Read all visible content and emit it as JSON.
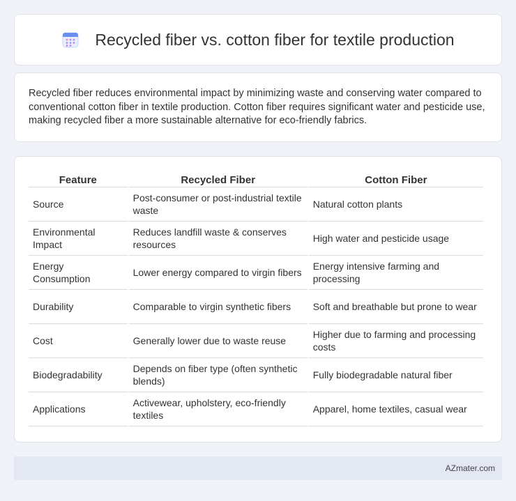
{
  "header": {
    "title": "Recycled fiber vs. cotton fiber for textile production",
    "icon": "calendar-icon"
  },
  "summary": {
    "text": "Recycled fiber reduces environmental impact by minimizing waste and conserving water compared to conventional cotton fiber in textile production. Cotton fiber requires significant water and pesticide use, making recycled fiber a more sustainable alternative for eco-friendly fabrics."
  },
  "table": {
    "headers": [
      "Feature",
      "Recycled Fiber",
      "Cotton Fiber"
    ],
    "rows": [
      [
        "Source",
        "Post-consumer or post-industrial textile waste",
        "Natural cotton plants"
      ],
      [
        "Environmental Impact",
        "Reduces landfill waste & conserves resources",
        "High water and pesticide usage"
      ],
      [
        "Energy Consumption",
        "Lower energy compared to virgin fibers",
        "Energy intensive farming and processing"
      ],
      [
        "Durability",
        "Comparable to virgin synthetic fibers",
        "Soft and breathable but prone to wear"
      ],
      [
        "Cost",
        "Generally lower due to waste reuse",
        "Higher due to farming and processing costs"
      ],
      [
        "Biodegradability",
        "Depends on fiber type (often synthetic blends)",
        "Fully biodegradable natural fiber"
      ],
      [
        "Applications",
        "Activewear, upholstery, eco-friendly textiles",
        "Apparel, home textiles, casual wear"
      ]
    ]
  },
  "footer": {
    "brand": "AZmater.com"
  },
  "colors": {
    "background": "#f0f2f7",
    "card": "#ffffff",
    "footer": "#e4e8f3",
    "icon_accent": "#6b8ff0"
  }
}
